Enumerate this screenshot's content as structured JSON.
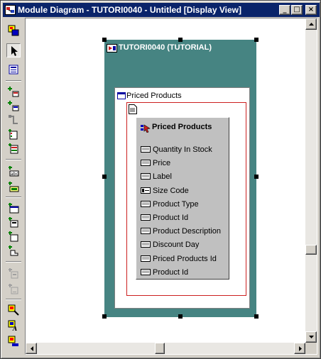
{
  "window": {
    "title": "Module Diagram - TUTORI0040 - Untitled [Display View]",
    "buttons": [
      "_",
      "□",
      "×"
    ]
  },
  "toolbar": {
    "tools": [
      {
        "name": "layout-icon"
      },
      {
        "name": "select-pointer-icon",
        "selected": true
      },
      {
        "name": "module-component-icon"
      },
      {
        "name": "create-base-table-usage-icon"
      },
      {
        "name": "create-lookup-table-usage-icon"
      },
      {
        "name": "create-link-icon"
      },
      {
        "name": "create-key-based-link-icon"
      },
      {
        "name": "create-subquery-icon"
      },
      {
        "name": "create-bound-item-icon"
      },
      {
        "name": "create-unbound-item-icon"
      },
      {
        "name": "create-window-icon"
      },
      {
        "name": "create-action-item-icon"
      },
      {
        "name": "create-navigation-item-icon"
      },
      {
        "name": "create-item-group-icon"
      },
      {
        "name": "disabled-tool-icon"
      },
      {
        "name": "disabled-tool-icon-2"
      },
      {
        "name": "format-icon"
      },
      {
        "name": "font-icon"
      },
      {
        "name": "color-icon"
      }
    ]
  },
  "diagram": {
    "module": {
      "title": "TUTORI0040 (TUTORIAL)"
    },
    "window_form": {
      "title": "Priced Products"
    },
    "table_usage": {
      "title": "Priced Products",
      "attributes": [
        {
          "label": "Quantity In Stock",
          "type": "abc"
        },
        {
          "label": "Price",
          "type": "abc"
        },
        {
          "label": "Label",
          "type": "abc"
        },
        {
          "label": "Size Code",
          "type": "list"
        },
        {
          "label": "Product Type",
          "type": "abc"
        },
        {
          "label": "Product Id",
          "type": "abc"
        },
        {
          "label": "Product Description",
          "type": "abc"
        },
        {
          "label": "Discount Day",
          "type": "abc"
        },
        {
          "label": "Priced Products Id",
          "type": "abc"
        },
        {
          "label": "Product Id",
          "type": "abc"
        }
      ]
    }
  },
  "colors": {
    "module_bg": "#468482",
    "title_bar": "#0a246a",
    "block_border": "#cc2020"
  }
}
